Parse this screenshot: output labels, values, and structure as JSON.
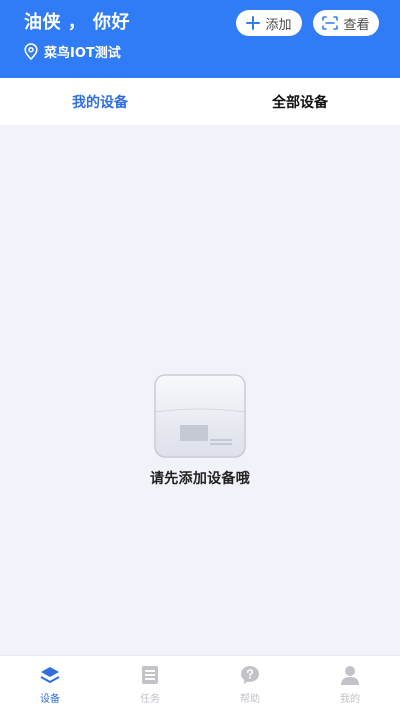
{
  "header": {
    "greeting": "油侠 ， 你好",
    "location": "菜鸟IOT测试",
    "add_label": "添加",
    "view_label": "查看",
    "bg_color": "#2f7cf6"
  },
  "tabs": [
    {
      "label": "我的设备",
      "active": true
    },
    {
      "label": "全部设备",
      "active": false
    }
  ],
  "empty_state": {
    "icon": "empty-device-icon",
    "message": "请先添加设备哦"
  },
  "bottom_nav": [
    {
      "label": "设备",
      "icon": "layers-icon",
      "active": true
    },
    {
      "label": "任务",
      "icon": "task-list-icon",
      "active": false
    },
    {
      "label": "帮助",
      "icon": "help-chat-icon",
      "active": false
    },
    {
      "label": "我的",
      "icon": "user-icon",
      "active": false
    }
  ],
  "colors": {
    "accent": "#2f6fe0",
    "inactive": "#c2c2c8",
    "background": "#f2f3fa"
  }
}
